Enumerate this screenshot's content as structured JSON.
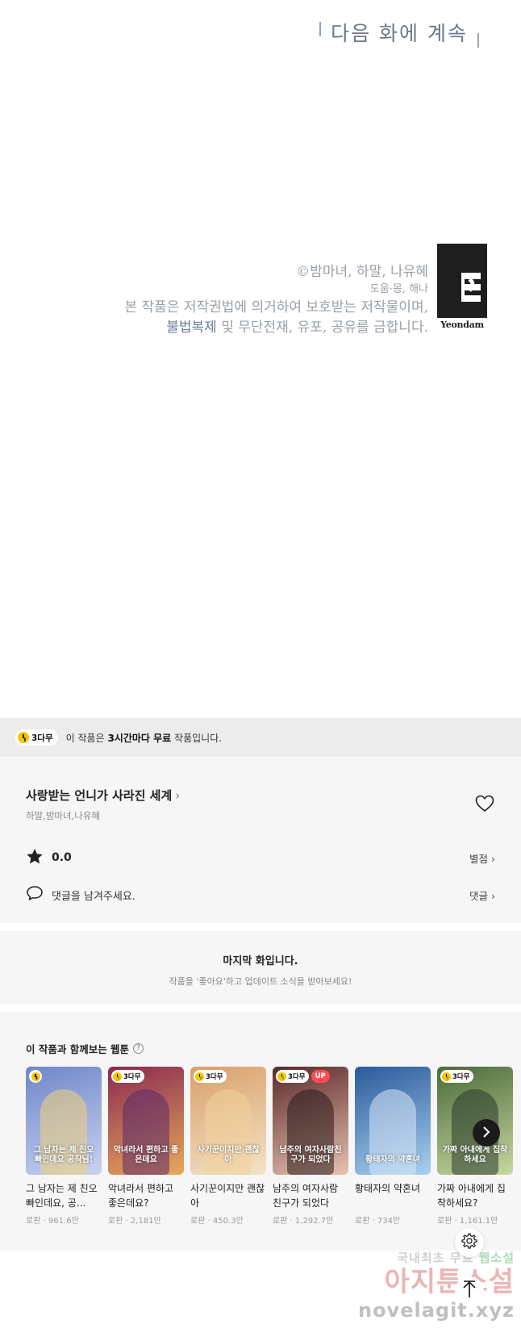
{
  "comic": {
    "to_be_continued": "다음 화에 계속",
    "credits": {
      "line1": "©밤마녀, 하말, 나유혜",
      "line2": "도움·몽, 해나",
      "line3": "본 작품은 저작권법에 의거하여 보호받는 저작물이며,",
      "line4_em": "불법복제",
      "line4_rest": " 및 무단전재, 유포, 공유를 금합니다."
    },
    "publisher_logo": "Yeondam"
  },
  "banner": {
    "badge": "3다무",
    "msg_prefix": "이 작품은 ",
    "msg_bold": "3시간마다 무료",
    "msg_suffix": " 작품입니다."
  },
  "series": {
    "title": "사랑받는 언니가 사라진 세계",
    "chevron": "›",
    "authors": "하말,밤마녀,나유혜",
    "rating": "0.0",
    "rating_link": "별점 ›",
    "comment_prompt": "댓글을 남겨주세요.",
    "comment_link": "댓글 ›"
  },
  "last_episode": {
    "title": "마지막 화입니다.",
    "subtitle": "작품을 '좋아요'하고 업데이트 소식을 받아보세요!"
  },
  "recommend": {
    "title": "이 작품과 함께보는 웹툰",
    "help": "?",
    "items": [
      {
        "name": "그 남자는 제 친오빠인데요, 공...",
        "meta": "로판 · 961.6만",
        "badge": "icon",
        "up": "",
        "cover_text": "그 남자는 제 친오빠인데요 공작님!",
        "c1": "#6f86c9",
        "c2": "#c9d2f0",
        "fig": "#f2d27a"
      },
      {
        "name": "악녀라서 편하고 좋은데요?",
        "meta": "로판 · 2,181만",
        "badge": "3다무",
        "up": "",
        "cover_text": "악녀라서 편하고 좋은데요",
        "c1": "#8a2a52",
        "c2": "#e8a85a",
        "fig": "#5a2a6a"
      },
      {
        "name": "사기꾼이지만 괜찮아",
        "meta": "로판 · 450.3만",
        "badge": "3다무",
        "up": "",
        "cover_text": "사기꾼이지만 괜찮아",
        "c1": "#d9a06a",
        "c2": "#f3e3c8",
        "fig": "#f0d29a"
      },
      {
        "name": "남주의 여자사람 친구가 되었다",
        "meta": "로판 · 1,292.7만",
        "badge": "3다무",
        "up": "UP",
        "cover_text": "남주의 여자사람친구가 되었다",
        "c1": "#5a2a2a",
        "c2": "#e8c2b0",
        "fig": "#2a1a1a"
      },
      {
        "name": "황태자의 약혼녀",
        "meta": "로판 · 734만",
        "badge": "",
        "up": "",
        "cover_text": "황태자의 약혼녀",
        "c1": "#2a5a9a",
        "c2": "#a8d0f0",
        "fig": "#d8e8f8"
      },
      {
        "name": "가짜 아내에게 집착하세요?",
        "meta": "로판 · 1,161.1만",
        "badge": "3다무",
        "up": "",
        "cover_text": "가짜 아내에게 집착하세요",
        "c1": "#4a6a3a",
        "c2": "#c8d8a0",
        "fig": "#2a3a2a"
      }
    ]
  },
  "watermark": {
    "line1_a": "국내최초 무료 ",
    "line1_b": "웹소설",
    "line2": "아지툰소설",
    "line3": "novelagit.xyz"
  }
}
